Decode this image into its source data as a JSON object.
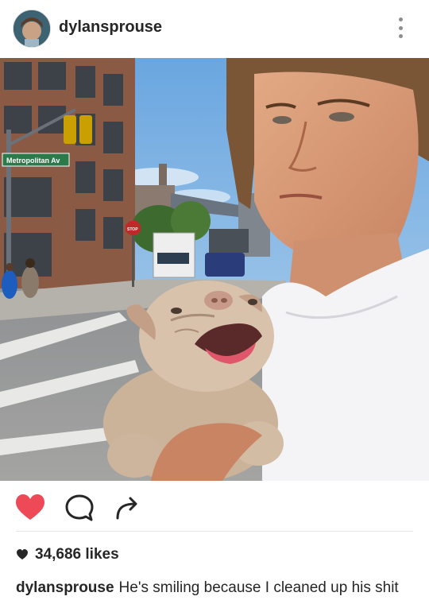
{
  "post": {
    "username": "dylansprouse",
    "likes": "34,686 likes",
    "caption_user": "dylansprouse",
    "caption_text": "He's smiling because I cleaned up his shit"
  },
  "photo": {
    "street_sign": "Metropolitan Av",
    "stop_sign": "STOP"
  },
  "icons": {
    "avatar": "profile-avatar",
    "more": "vertical-ellipsis-icon",
    "like": "heart-icon",
    "comment": "comment-bubble-icon",
    "share": "share-arrow-icon",
    "likes_heart": "small-heart-icon"
  },
  "colors": {
    "like_active": "#ed4956",
    "text": "#262626",
    "muted": "#8e8e8e"
  }
}
